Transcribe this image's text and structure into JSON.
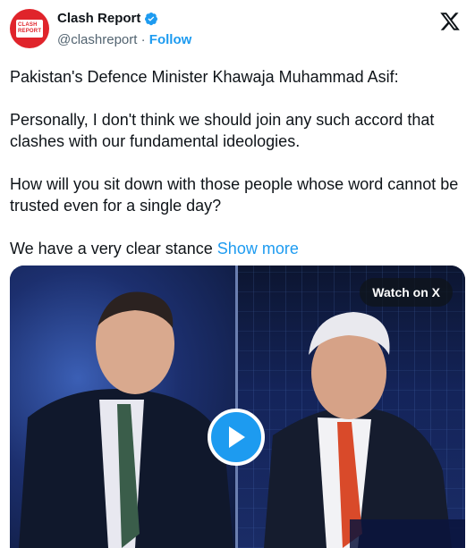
{
  "author": {
    "display_name": "Clash Report",
    "handle": "@clashreport",
    "separator": "·",
    "follow_label": "Follow",
    "avatar_text_line1": "CLASH",
    "avatar_text_line2": "REPORT"
  },
  "post": {
    "line1": "Pakistan's Defence Minister Khawaja Muhammad Asif:",
    "line2": "Personally, I don't think we should join any such accord that clashes with our fundamental ideologies.",
    "line3": "How will you sit down with those people whose word cannot be trusted even for a single day?",
    "line4": "We have a very clear stance",
    "show_more_label": "Show more"
  },
  "media": {
    "watch_label": "Watch on X",
    "state": "paused"
  },
  "colors": {
    "accent": "#1d9bf0",
    "brand_red": "#e0242b",
    "text": "#0f1419",
    "secondary_text": "#536471"
  },
  "icons": [
    "verified-badge-icon",
    "x-logo-icon",
    "play-icon"
  ]
}
